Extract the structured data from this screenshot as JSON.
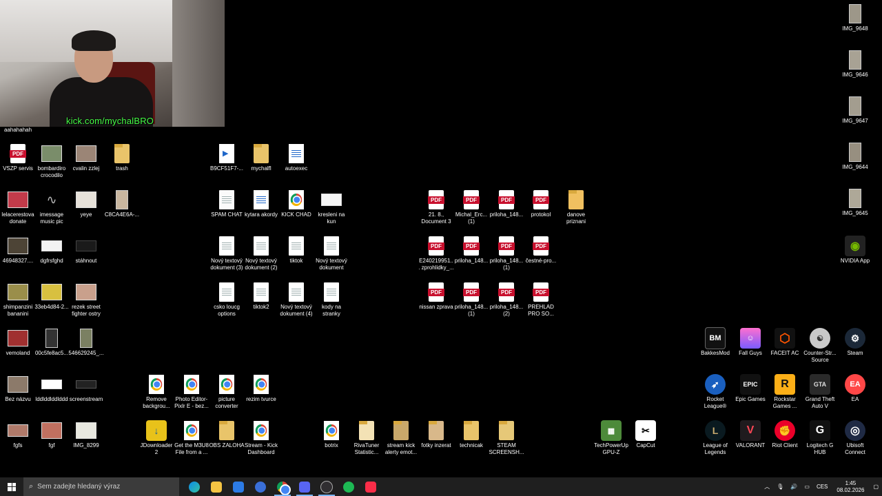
{
  "webcam": {
    "url": "kick.com/mychalBRO",
    "chat": "aahahahah"
  },
  "icons": {
    "vszp": "VSZP servis",
    "bombardiro": "bombardiro crocodilo",
    "cvalin": "cvalin zzlej",
    "trash": "trash",
    "b9cf": "B9CF51F7-...",
    "mychalfl": "mychalfl",
    "autoexec": "autoexec",
    "lelacerestova": "lelacerestova donate",
    "imessage": "imessage music pic",
    "yeye": "yeye",
    "c8ca": "C8CA4E6A-...",
    "spam": "SPAM CHAT",
    "kytara": "kytara akordy",
    "kickchad": "KICK CHAD",
    "kresleni": "kresleni na kun",
    "pdf21": "21. 8., Document 3",
    "michal": "Michal_Erc... (1)",
    "priloha1": "priloha_148...",
    "protokol": "protokol",
    "danove": "danove priznani",
    "n469": "46948327....",
    "dgfrs": "dgfrsfghd",
    "stahnout": "stáhnout",
    "novy3": "Nový textový dokument (3)",
    "novy2": "Nový textový dokument (2)",
    "tiktok": "tiktok",
    "novy": "Nový textový dokument",
    "e240": "E240219951... zprohlidky_...",
    "priloha2": "priloha_148...",
    "priloha3": "priloha_148... (1)",
    "cestne": "čestné-pro...",
    "shimp": "shimpanzini bananini",
    "n33eb": "33eb4d84-2...",
    "rezek": "rezek street fighter ostry",
    "csko": "csko loucg options",
    "tiktok2": "tiktok2",
    "novy4": "Nový textový dokument (4)",
    "kody": "kody na stranky",
    "nissan": "nissan zprava",
    "priloha4": "priloha_148... (1)",
    "priloha5": "priloha_148... (2)",
    "prehlad": "PREHLAD PRO SO...",
    "vemoland": "vemoland",
    "n00c5": "00c5fe8ac5...",
    "n5466": "546629245_...",
    "bez": "Bez názvu",
    "lddd": "lddlddlddlddd",
    "screenstream": "screenstream",
    "remove": "Remove backgrou...",
    "photoeditor": "Photo Editor- Pixlr E - bez...",
    "picture": "picture converter",
    "rezim": "rezim tvurce",
    "fgfs": "fgfs",
    "fgf": "fgf",
    "img8299": "IMG_8299",
    "jdownloader": "JDownloader 2",
    "m3u8": "Get the M3U8 File from a ...",
    "obs": "OBS ZALOHA",
    "streamkick": "Stream - Kick Dashboard",
    "botrix": "botrix",
    "rivatuner": "RivaTuner Statistic...",
    "streamalerty": "stream kick alerty emot...",
    "fotky": "fotky inzerat",
    "technicak": "technicak",
    "steamss": "STEAM SCREENSH...",
    "techpower": "TechPowerUp GPU-Z",
    "capcut": "CapCut",
    "img9648": "IMG_9648",
    "img9646": "IMG_9646",
    "img9647": "IMG_9647",
    "img9644": "IMG_9644",
    "img9645": "IMG_9645",
    "nvidia": "NVIDIA App",
    "bakkes": "BakkesMod",
    "fallguys": "Fall Guys",
    "faceit": "FACEIT AC",
    "cs": "Counter-Str... Source",
    "steam": "Steam",
    "rocket": "Rocket League®",
    "epic": "Epic Games",
    "rockstar": "Rockstar Games ...",
    "gta": "Grand Theft Auto V",
    "ea": "EA",
    "lol": "League of Legends",
    "valorant": "VALORANT",
    "riot": "Riot Client",
    "logitech": "Logitech G HUB",
    "ubisoft": "Ubisoft Connect"
  },
  "glyphs": {
    "epic": "EPIC",
    "ea": "EA",
    "rockstar": "R",
    "bakkes": "BM",
    "valorant": "V",
    "pdf": "PDF"
  },
  "taskbar": {
    "search_placeholder": "Sem zadejte hledaný výraz",
    "lang": "CES",
    "time": "1:45",
    "date": "08.02.2026"
  }
}
